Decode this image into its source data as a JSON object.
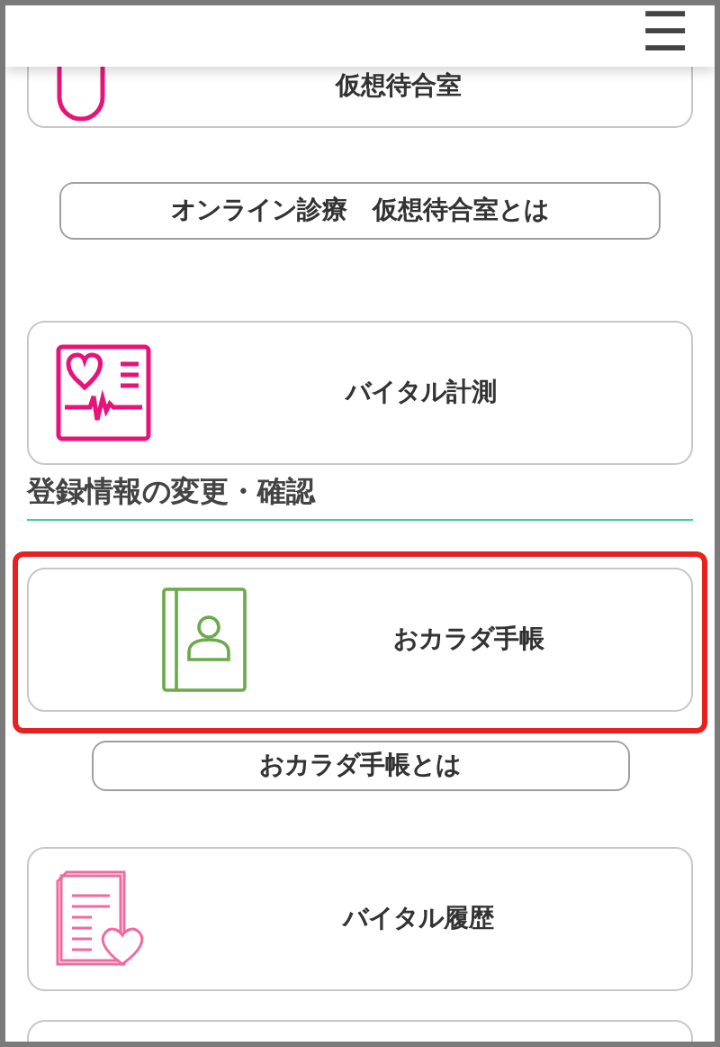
{
  "header": {
    "menu_button": "☰"
  },
  "items": [
    {
      "kind": "card",
      "label": "仮想待合室",
      "highlighted": false
    },
    {
      "kind": "button",
      "label": "オンライン診療　仮想待合室とは"
    },
    {
      "kind": "card",
      "label": "バイタル計測",
      "highlighted": false
    },
    {
      "kind": "heading",
      "label": "登録情報の変更・確認"
    },
    {
      "kind": "card",
      "label": "おカラダ手帳",
      "highlighted": true
    },
    {
      "kind": "button",
      "label": "おカラダ手帳とは"
    },
    {
      "kind": "card",
      "label": "バイタル履歴",
      "highlighted": false
    },
    {
      "kind": "blank_card"
    }
  ]
}
